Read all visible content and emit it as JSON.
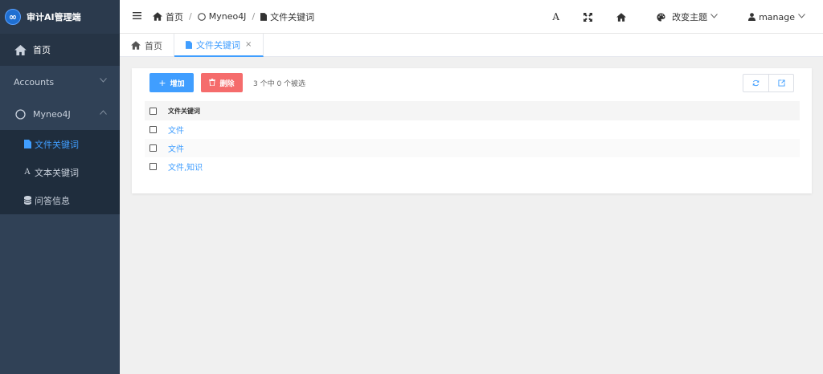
{
  "brand": {
    "logo_glyph": "∞",
    "title": "审计AI管理端"
  },
  "sidebar": {
    "home": {
      "label": "首页",
      "icon": "home-icon"
    },
    "accounts": {
      "label": "Accounts",
      "icon": "chevron-down-icon"
    },
    "myneo4j": {
      "label": "Myneo4J",
      "icon": "circle-icon",
      "children": [
        {
          "label": "文件关键词",
          "icon": "document-icon"
        },
        {
          "label": "文本关键词",
          "icon": "text-icon"
        },
        {
          "label": "问答信息",
          "icon": "database-icon"
        }
      ]
    }
  },
  "header": {
    "menu_icon": "hamburger-icon",
    "breadcrumb": [
      {
        "label": "首页",
        "icon": "home-icon"
      },
      {
        "label": "Myneo4J",
        "icon": "circle-icon"
      },
      {
        "label": "文件关键词",
        "icon": "document-icon"
      }
    ],
    "font_icon_glyph": "A",
    "theme_label": "改变主题",
    "user_label": "manage"
  },
  "tabs": [
    {
      "label": "首页",
      "icon": "home-icon"
    },
    {
      "label": "文件关键词",
      "icon": "document-icon",
      "close": "×"
    }
  ],
  "toolbar": {
    "add_label": "增加",
    "add_glyph": "+",
    "delete_label": "删除",
    "selection_info": "3 个中 0 个被选"
  },
  "table": {
    "column": "文件关键词",
    "rows": [
      "文件",
      "文件",
      "文件,知识"
    ]
  },
  "colors": {
    "accent": "#409eff",
    "danger": "#f56c6c",
    "sidebar": "#304156"
  }
}
